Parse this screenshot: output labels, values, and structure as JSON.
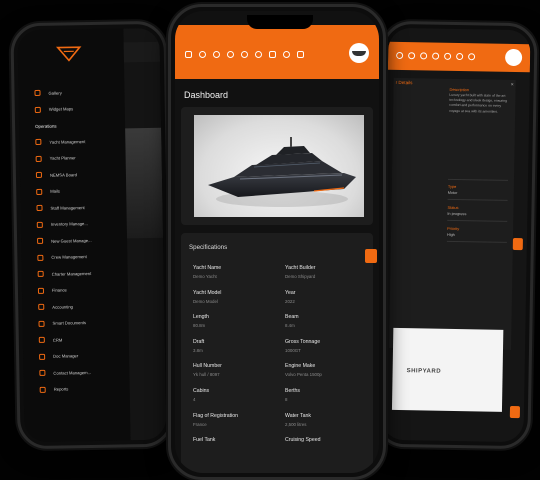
{
  "left_phone": {
    "menu": [
      {
        "label": "Gallery"
      },
      {
        "label": "Widget Maps"
      }
    ],
    "section_label": "Operations",
    "items": [
      {
        "label": "Yacht Management"
      },
      {
        "label": "Yacht Planner"
      },
      {
        "label": "NEMSA Board"
      },
      {
        "label": "Mails"
      },
      {
        "label": "Staff Management"
      },
      {
        "label": "Inventory Manage..."
      },
      {
        "label": "New Guest Manage..."
      },
      {
        "label": "Crew Management"
      },
      {
        "label": "Charter Management"
      },
      {
        "label": "Finance"
      },
      {
        "label": "Accounting"
      },
      {
        "label": "Smart Documents"
      },
      {
        "label": "CRM"
      },
      {
        "label": "Doc Manager"
      },
      {
        "label": "Contact Managem..."
      },
      {
        "label": "Reports"
      }
    ]
  },
  "center_phone": {
    "page_title": "Dashboard",
    "specs_title": "Specifications",
    "specs": [
      {
        "label": "Yacht Name",
        "value": "Demo Yacht"
      },
      {
        "label": "Yacht Builder",
        "value": "Demo Shipyard"
      },
      {
        "label": "Yacht Model",
        "value": "Demo Model"
      },
      {
        "label": "Year",
        "value": "2022"
      },
      {
        "label": "Length",
        "value": "80.8m"
      },
      {
        "label": "Beam",
        "value": "8.4m"
      },
      {
        "label": "Draft",
        "value": "3.8m"
      },
      {
        "label": "Gross Tonnage",
        "value": "1000GT"
      },
      {
        "label": "Hull Number",
        "value": "Yk hull / 8097"
      },
      {
        "label": "Engine Make",
        "value": "Volvo Penta 1500p"
      },
      {
        "label": "Cabins",
        "value": "4"
      },
      {
        "label": "Berths",
        "value": "8"
      },
      {
        "label": "Flag of Registration",
        "value": "France"
      },
      {
        "label": "Water Tank",
        "value": "2,500 litres"
      },
      {
        "label": "Fuel Tank",
        "value": ""
      },
      {
        "label": "Cruising Speed",
        "value": ""
      }
    ]
  },
  "right_phone": {
    "title": "r Details",
    "description_label": "Description",
    "description": "Luxury yacht built with state of the art technology and sleek design, ensuring comfort and performance on every voyage at sea with its amenities.",
    "fields": [
      {
        "label": "Type",
        "value": "Motor"
      },
      {
        "label": "Status",
        "value": "In progress"
      },
      {
        "label": "Priority",
        "value": "High"
      }
    ],
    "logo_text": "SHIPYARD"
  },
  "colors": {
    "accent": "#f06a12",
    "bg": "#020202"
  }
}
